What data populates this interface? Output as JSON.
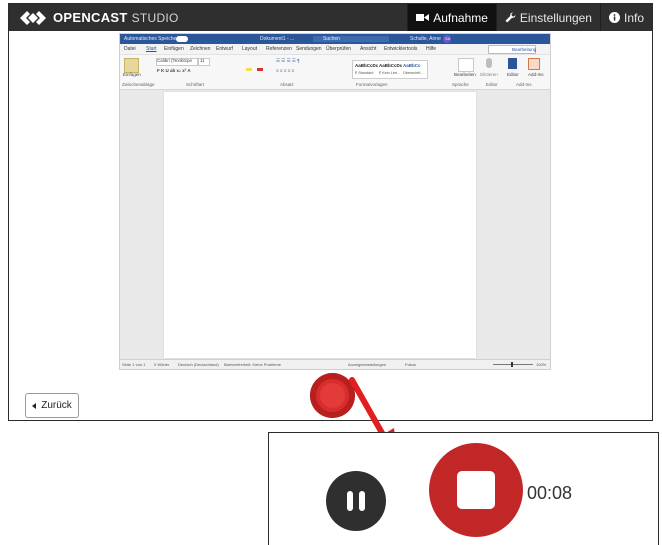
{
  "app": {
    "logo_text": "OPENCAST",
    "logo_suffix": "STUDIO"
  },
  "nav": {
    "record_label": "Aufnahme",
    "settings_label": "Einstellungen",
    "info_label": "Info"
  },
  "word_preview": {
    "titlebar": {
      "autosave": "Automatisches Speichern",
      "doc_name": "Dokument1 - ...",
      "search": "Suchen",
      "user": "Schulte, Anne",
      "user_initials": "SA"
    },
    "menu_tabs": [
      "Datei",
      "Start",
      "Einfügen",
      "Zeichnen",
      "Entwurf",
      "Layout",
      "Referenzen",
      "Sendungen",
      "Überprüfen",
      "Ansicht",
      "Entwicklertools",
      "Hilfe"
    ],
    "share_label": "Bearbeitung",
    "ribbon": {
      "paste": "Einfügen",
      "font_name": "Calibri (Textkörpe",
      "font_size": "11",
      "groups": [
        "Zwischenablage",
        "Schriftart",
        "Absatz",
        "Formatvorlagen",
        "Sprache",
        "Editor",
        "Add-Ins"
      ],
      "styles": [
        {
          "sample": "AaBbCcDc",
          "name": "¶ Standard"
        },
        {
          "sample": "AaBbCcDc",
          "name": "¶ Kein Lee..."
        },
        {
          "sample": "AaBbCc",
          "name": "Überschrif..."
        }
      ],
      "search_btn": "Bearbeiten",
      "dictate": "Diktieren",
      "editor": "Editor",
      "addins": "Add-Ins"
    },
    "status": {
      "page": "Seite 1 von 1",
      "words": "0 Wörter",
      "lang": "Deutsch (Deutschland)",
      "access": "Barrierefreiheit: Keine Probleme",
      "display": "Anzeigeeinstellungen",
      "focus": "Fokus",
      "zoom": "100%"
    }
  },
  "back_button_label": "Zurück",
  "controls": {
    "timer": "00:08"
  },
  "colors": {
    "topbar": "#2f2f2f",
    "record_red": "#c22727",
    "pause_dark": "#2f2f2f",
    "arrow_red": "#e02020",
    "word_blue": "#2b579a"
  }
}
